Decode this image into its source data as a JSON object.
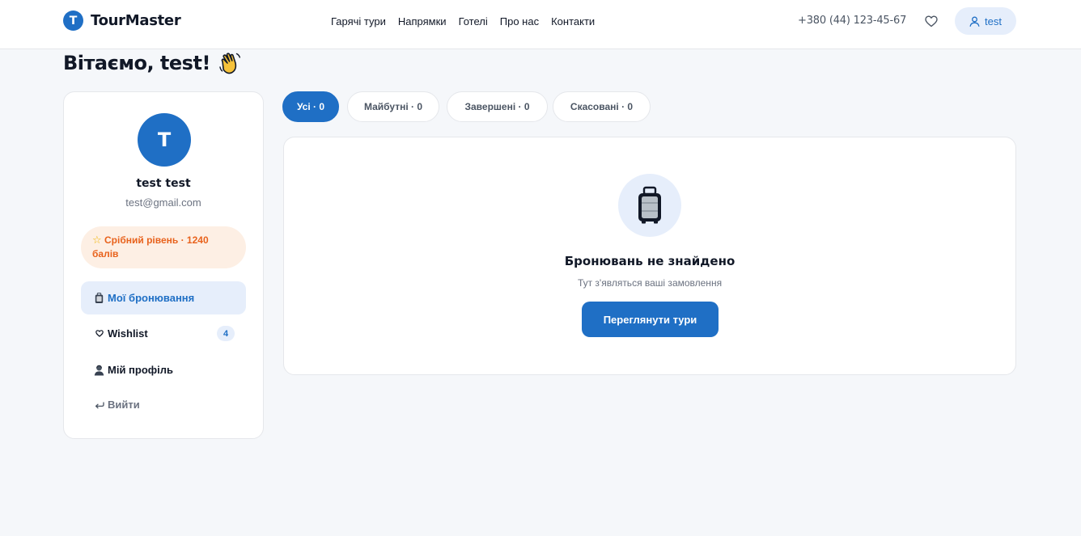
{
  "brand": {
    "logo_letter": "T",
    "name": "TourMaster"
  },
  "nav": {
    "items": [
      "Гарячі тури",
      "Напрямки",
      "Готелі",
      "Про нас",
      "Контакти"
    ]
  },
  "header": {
    "phone": "+380 (44) 123-45-67",
    "user_label": "test"
  },
  "welcome": {
    "text": "Вітаємо, test!"
  },
  "profile": {
    "avatar_letter": "T",
    "name": "test test",
    "email": "test@gmail.com",
    "level": "Срібний рівень · 1240 балів"
  },
  "sidebar": {
    "items": [
      {
        "label": "Мої бронювання",
        "icon": "luggage-icon"
      },
      {
        "label": "Wishlist",
        "icon": "heart-icon",
        "count": "4"
      },
      {
        "label": "Мій профіль",
        "icon": "person-icon"
      },
      {
        "label": "Вийти",
        "icon": "logout-arrow-icon"
      }
    ]
  },
  "tabs": [
    {
      "label": "Усі · 0"
    },
    {
      "label": "Майбутні · 0"
    },
    {
      "label": "Завершені · 0"
    },
    {
      "label": "Скасовані · 0"
    }
  ],
  "empty": {
    "title": "Бронювань не знайдено",
    "subtitle": "Тут з'являться ваші замовлення",
    "button": "Переглянути тури"
  },
  "colors": {
    "accent": "#1f6fc5",
    "accent_light": "#e6eefb",
    "level_text": "#e8621c",
    "level_bg": "#fdefe4"
  }
}
